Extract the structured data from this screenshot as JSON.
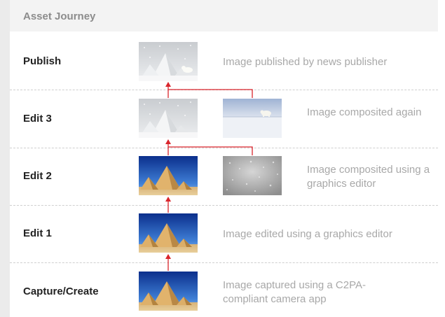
{
  "title": "Asset Journey",
  "stages": [
    {
      "label": "Publish",
      "description": "Image published by news publisher"
    },
    {
      "label": "Edit 3",
      "description": "Image composited again"
    },
    {
      "label": "Edit 2",
      "description": "Image composited using a graphics editor"
    },
    {
      "label": "Edit 1",
      "description": "Image edited using a graphics editor"
    },
    {
      "label": "Capture/Create",
      "description": "Image captured using a C2PA-compliant camera app"
    }
  ],
  "colors": {
    "arrow": "#d9252c",
    "label": "#222222",
    "description": "#a8a8a8",
    "title": "#8c8c8c"
  }
}
